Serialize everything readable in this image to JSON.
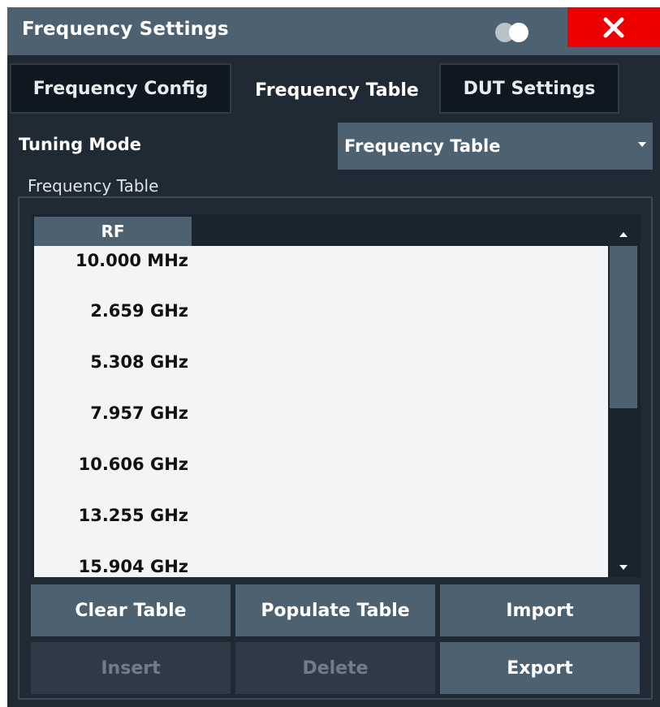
{
  "window": {
    "title": "Frequency Settings"
  },
  "tabs": [
    {
      "label": "Frequency Config",
      "active": false
    },
    {
      "label": "Frequency Table",
      "active": true
    },
    {
      "label": "DUT Settings",
      "active": false
    }
  ],
  "tuning_mode": {
    "label": "Tuning Mode",
    "value": "Frequency Table"
  },
  "frequency_table": {
    "section_label": "Frequency Table",
    "column_header": "RF",
    "rows": [
      "10.000 MHz",
      "2.659 GHz",
      "5.308 GHz",
      "7.957 GHz",
      "10.606 GHz",
      "13.255 GHz",
      "15.904 GHz"
    ]
  },
  "buttons": {
    "clear_table": "Clear Table",
    "populate_table": "Populate Table",
    "import": "Import",
    "insert": "Insert",
    "delete": "Delete",
    "export": "Export"
  },
  "icons": {
    "toggle": "display-toggle-icon",
    "close": "close-icon",
    "dropdown": "caret-down-icon",
    "scroll_up": "scroll-up-icon",
    "scroll_down": "scroll-down-icon"
  },
  "colors": {
    "title_bar": "#4e6170",
    "dialog_bg": "#1f2a34",
    "close_red": "#ee0000",
    "table_bg": "#f2f4f6"
  }
}
